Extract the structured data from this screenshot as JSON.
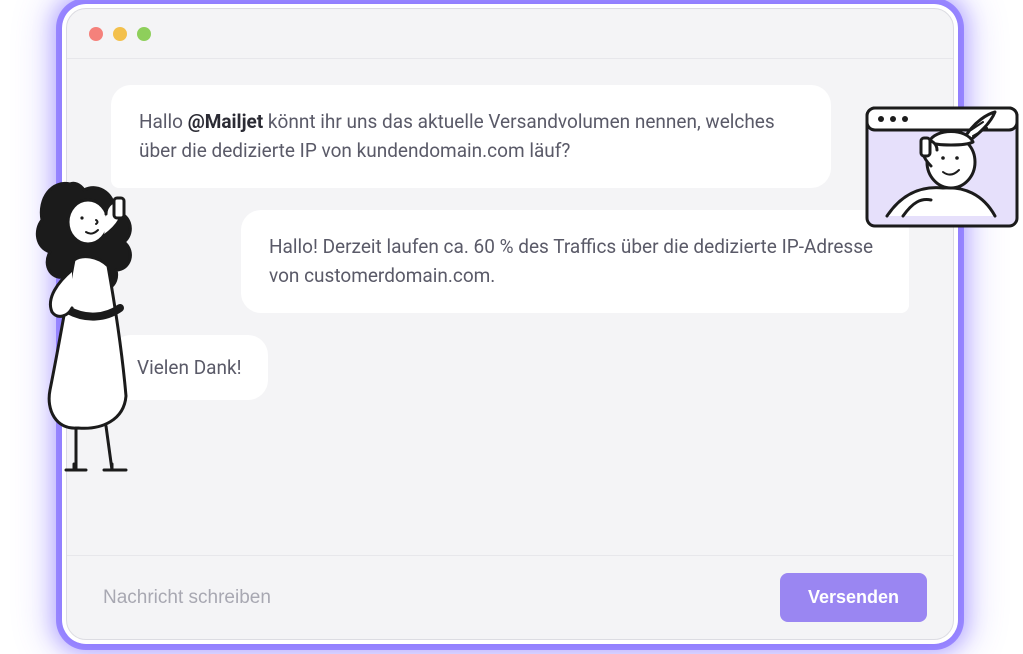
{
  "colors": {
    "accent": "#9a86f2",
    "glow": "#6c52ff",
    "window_bg": "#f4f4f6",
    "bubble_bg": "#ffffff",
    "text": "#5a5a68"
  },
  "titlebar": {
    "dots": [
      "red",
      "yellow",
      "green"
    ]
  },
  "messages": {
    "m1": {
      "prefix": "Hallo ",
      "mention": "@Mailjet",
      "rest": " könnt ihr uns das aktuelle Versandvolumen nennen, welches über die dedizierte IP von kundendomain.com läuf?"
    },
    "m2": {
      "text": "Hallo! Derzeit laufen ca. 60 % des Traffics über die dedizierte IP-Adresse von customerdomain.com."
    },
    "m3": {
      "text": "Vielen Dank!"
    }
  },
  "composer": {
    "placeholder": "Nachricht schreiben",
    "send_label": "Versenden"
  },
  "decor": {
    "left_figure": "woman-phone-illustration",
    "right_figure": "hermes-phone-illustration"
  }
}
